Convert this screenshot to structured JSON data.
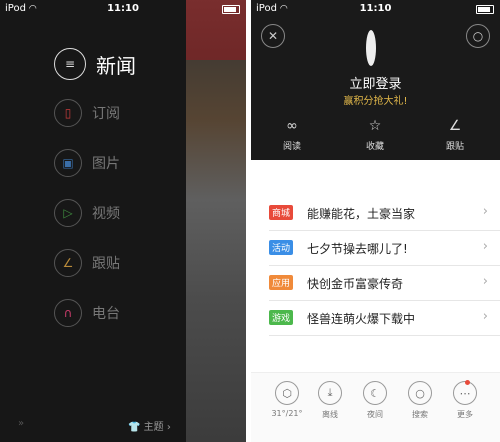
{
  "status_left": {
    "carrier": "iPod",
    "time": "11:10"
  },
  "status_right": {
    "carrier": "iPod",
    "time": "11:10"
  },
  "left_menu": {
    "items": [
      {
        "label": "新闻",
        "icon": "news-icon",
        "color": "#dddddd"
      },
      {
        "label": "订阅",
        "icon": "bookmark-icon",
        "color": "#c83c3c"
      },
      {
        "label": "图片",
        "icon": "image-icon",
        "color": "#3a6ea8"
      },
      {
        "label": "视频",
        "icon": "play-icon",
        "color": "#3f8c3f"
      },
      {
        "label": "跟贴",
        "icon": "pen-icon",
        "color": "#b88a3a"
      },
      {
        "label": "电台",
        "icon": "headphones-icon",
        "color": "#c83c6a"
      }
    ],
    "theme_label": "主题"
  },
  "user_panel": {
    "login_label": "立即登录",
    "promo_text": "赢积分抢大礼!",
    "actions": [
      {
        "label": "阅读",
        "icon": "glasses-icon"
      },
      {
        "label": "收藏",
        "icon": "star-icon"
      },
      {
        "label": "跟贴",
        "icon": "pen-icon"
      }
    ]
  },
  "promo_list": [
    {
      "tag": "商城",
      "tag_color": "#e84a3a",
      "text": "能赚能花，土豪当家"
    },
    {
      "tag": "活动",
      "tag_color": "#3a8ee6",
      "text": "七夕节操去哪儿了!"
    },
    {
      "tag": "应用",
      "tag_color": "#f08a3a",
      "text": "快创金币富豪传奇"
    },
    {
      "tag": "游戏",
      "tag_color": "#4cb84c",
      "text": "怪兽连萌火爆下载中"
    }
  ],
  "bottom_bar": [
    {
      "label": "31°/21°",
      "icon": "weather-icon"
    },
    {
      "label": "离线",
      "icon": "download-icon"
    },
    {
      "label": "夜间",
      "icon": "moon-icon"
    },
    {
      "label": "搜索",
      "icon": "search-icon"
    },
    {
      "label": "更多",
      "icon": "more-icon"
    }
  ]
}
